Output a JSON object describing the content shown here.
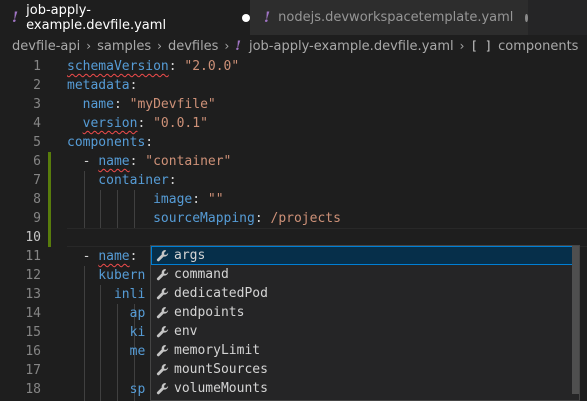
{
  "tabs": [
    {
      "icon": "!",
      "label": "job-apply-example.devfile.yaml",
      "active": true,
      "modified": true
    },
    {
      "icon": "!",
      "label": "nodejs.devworkspacetemplate.yaml",
      "active": false,
      "modified": true
    }
  ],
  "breadcrumb": {
    "items": [
      "devfile-api",
      "samples",
      "devfiles"
    ],
    "file_icon": "!",
    "file": "job-apply-example.devfile.yaml",
    "symbol_icon": "[ ]",
    "symbol": "components"
  },
  "editor": {
    "lines": [
      {
        "n": "1",
        "tokens": [
          {
            "t": "schemaVersion",
            "c": "k",
            "sq": true
          },
          {
            "t": ": ",
            "c": "p"
          },
          {
            "t": "\"2.0.0\"",
            "c": "s"
          }
        ]
      },
      {
        "n": "2",
        "tokens": [
          {
            "t": "metadata",
            "c": "k"
          },
          {
            "t": ":",
            "c": "p"
          }
        ]
      },
      {
        "n": "3",
        "tokens": [
          {
            "t": "  name",
            "c": "k"
          },
          {
            "t": ": ",
            "c": "p"
          },
          {
            "t": "\"myDevfile\"",
            "c": "s"
          }
        ]
      },
      {
        "n": "4",
        "tokens": [
          {
            "t": "  ",
            "c": "p"
          },
          {
            "t": "version",
            "c": "k",
            "sq": true
          },
          {
            "t": ": ",
            "c": "p"
          },
          {
            "t": "\"0.0.1\"",
            "c": "s"
          }
        ]
      },
      {
        "n": "5",
        "tokens": [
          {
            "t": "components",
            "c": "k"
          },
          {
            "t": ":",
            "c": "p"
          }
        ]
      },
      {
        "n": "6",
        "tokens": [
          {
            "t": "  - ",
            "c": "p"
          },
          {
            "t": "name",
            "c": "k",
            "sq": true
          },
          {
            "t": ": ",
            "c": "p"
          },
          {
            "t": "\"container\"",
            "c": "s"
          }
        ]
      },
      {
        "n": "7",
        "tokens": [
          {
            "t": "    container",
            "c": "k"
          },
          {
            "t": ":",
            "c": "p"
          }
        ]
      },
      {
        "n": "8",
        "tokens": [
          {
            "t": "           image",
            "c": "k"
          },
          {
            "t": ": ",
            "c": "p"
          },
          {
            "t": "\"\"",
            "c": "s"
          }
        ]
      },
      {
        "n": "9",
        "tokens": [
          {
            "t": "           sourceMapping",
            "c": "k"
          },
          {
            "t": ": ",
            "c": "p"
          },
          {
            "t": "/projects",
            "c": "s"
          }
        ]
      },
      {
        "n": "10",
        "tokens": []
      },
      {
        "n": "11",
        "tokens": [
          {
            "t": "  - ",
            "c": "p"
          },
          {
            "t": "name",
            "c": "k",
            "sq": true
          },
          {
            "t": ":",
            "c": "p"
          }
        ]
      },
      {
        "n": "12",
        "tokens": [
          {
            "t": "    kubern",
            "c": "k"
          }
        ]
      },
      {
        "n": "13",
        "tokens": [
          {
            "t": "      inli",
            "c": "k"
          }
        ]
      },
      {
        "n": "14",
        "tokens": [
          {
            "t": "        ap",
            "c": "k"
          }
        ]
      },
      {
        "n": "15",
        "tokens": [
          {
            "t": "        ki",
            "c": "k"
          }
        ]
      },
      {
        "n": "16",
        "tokens": [
          {
            "t": "        me",
            "c": "k"
          }
        ]
      },
      {
        "n": "17",
        "tokens": []
      },
      {
        "n": "18",
        "tokens": [
          {
            "t": "        sp",
            "c": "k"
          }
        ]
      }
    ]
  },
  "suggest": {
    "icon": "wrench-icon",
    "items": [
      "args",
      "command",
      "dedicatedPod",
      "endpoints",
      "env",
      "memoryLimit",
      "mountSources",
      "volumeMounts"
    ],
    "selected": 0
  },
  "colors": {
    "accent": "#007fd4",
    "yaml_icon": "#a074c4",
    "key": "#569cd6",
    "string": "#ce9178",
    "error": "#f14c4c",
    "modified_gutter": "#587c0c"
  }
}
